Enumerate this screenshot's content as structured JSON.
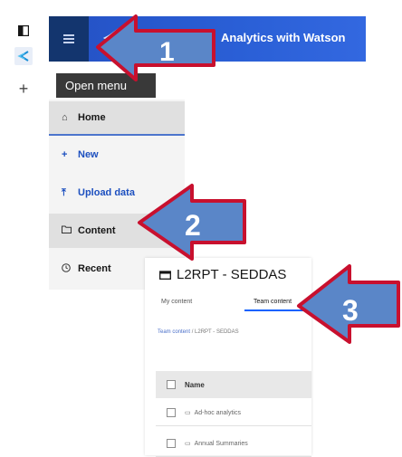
{
  "header": {
    "title": "Analytics with Watson",
    "menu_tooltip": "Open menu"
  },
  "left_strip": {
    "icons": [
      "panel-icon",
      "cognos-logo-icon",
      "plus-icon"
    ]
  },
  "side_menu": {
    "items": [
      {
        "label": "Home",
        "icon": "home-icon"
      },
      {
        "label": "New",
        "icon": "plus-icon"
      },
      {
        "label": "Upload data",
        "icon": "upload-icon"
      },
      {
        "label": "Content",
        "icon": "folder-icon"
      },
      {
        "label": "Recent",
        "icon": "clock-icon"
      }
    ]
  },
  "content_panel": {
    "title": "L2RPT - SEDDAS",
    "tabs": [
      "My content",
      "Team content"
    ],
    "breadcrumb": {
      "link": "Team content",
      "current": "L2RPT - SEDDAS"
    },
    "table": {
      "column": "Name",
      "rows": [
        "Ad-hoc analytics",
        "Annual Summaries"
      ]
    }
  },
  "annotations": {
    "arrow_1": "1",
    "arrow_2": "2",
    "arrow_3": "3",
    "arrow_color": "#5a86c8",
    "outline_color": "#c8102e"
  }
}
